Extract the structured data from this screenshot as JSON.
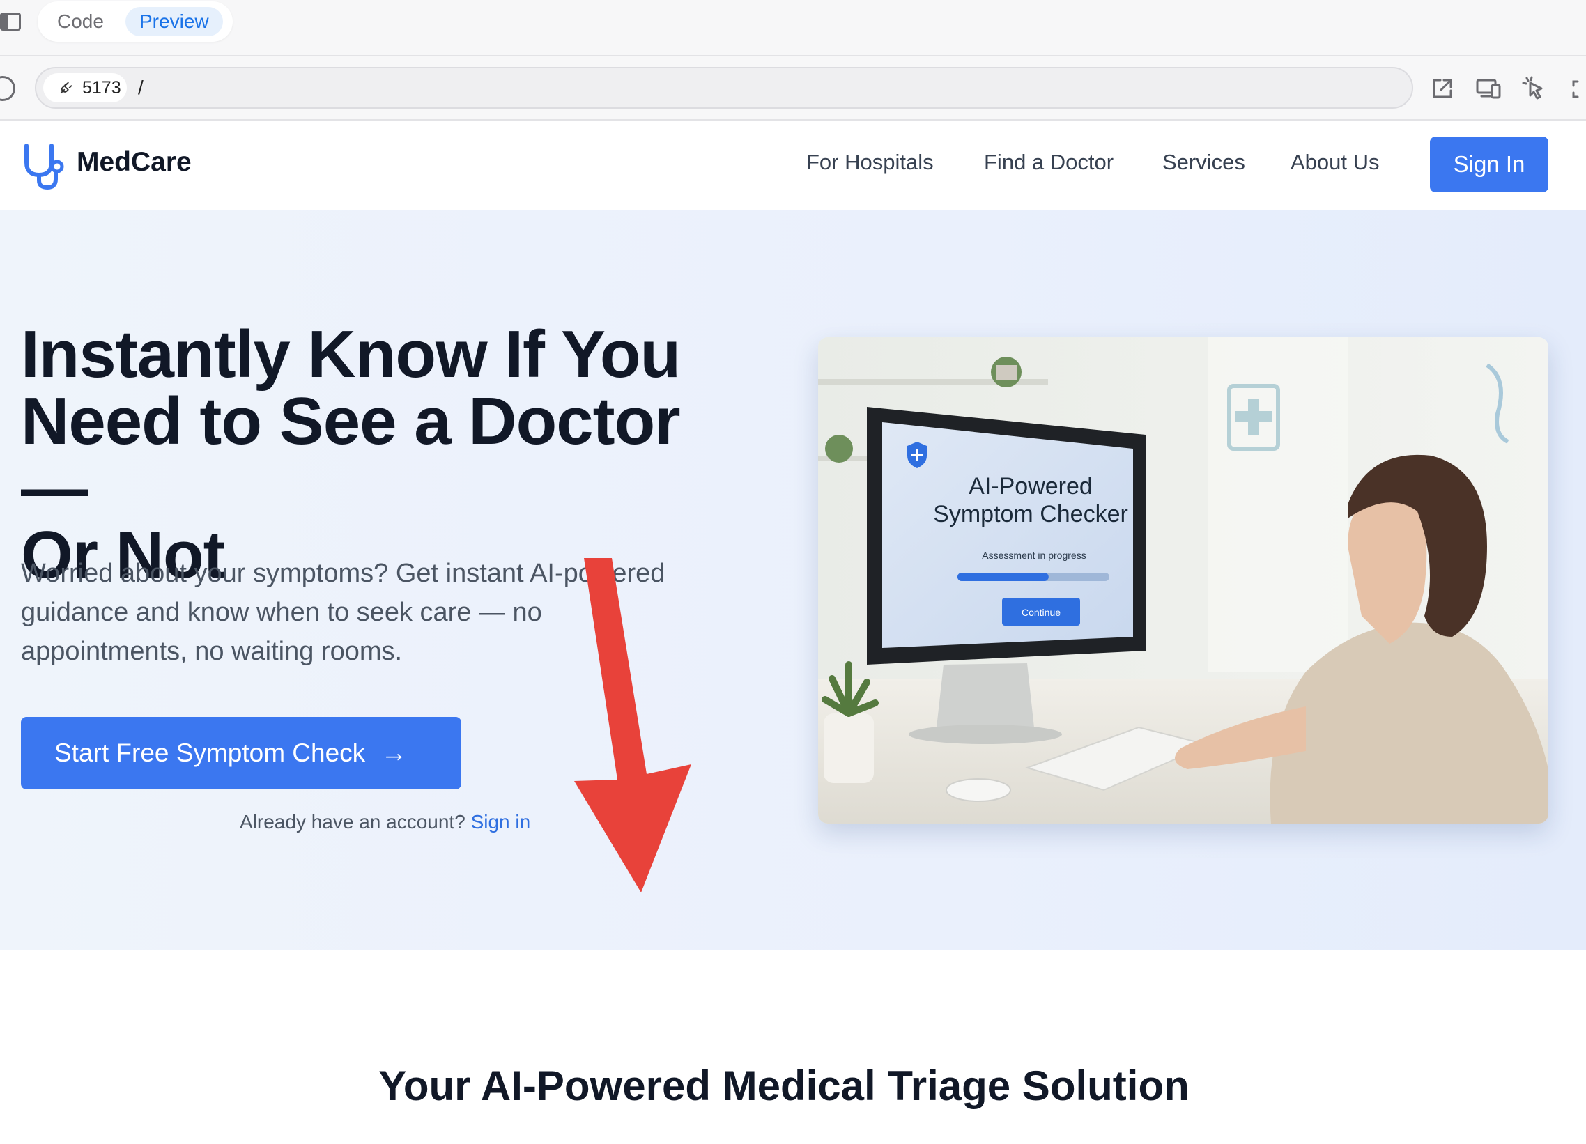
{
  "browser": {
    "tabs": [
      "Code",
      "Preview"
    ],
    "active_tab": "Preview",
    "port": "5173",
    "path": "/",
    "icons": [
      "panel-toggle-icon",
      "reload-icon",
      "plug-icon",
      "open-external-icon",
      "responsive-devices-icon",
      "select-element-icon",
      "fullscreen-icon"
    ]
  },
  "nav": {
    "logo_text": "MedCare",
    "links": [
      "For Hospitals",
      "Find a Doctor",
      "Services",
      "About Us"
    ],
    "signin": "Sign In"
  },
  "hero": {
    "title_lines": [
      "Instantly Know If You",
      "Need to See a Doctor —",
      "Or Not"
    ],
    "subtitle_lines": [
      "Worried about your symptoms? Get instant AI-powered",
      "guidance and know when to seek care — no",
      "appointments, no waiting rooms."
    ],
    "cta": "Start Free Symptom Check",
    "already_text": "Already have an account?",
    "signin_link": "Sign in",
    "image": {
      "screen_title_lines": [
        "AI-Powered",
        "Symptom Checker"
      ],
      "screen_status": "Assessment in progress",
      "screen_button": "Continue",
      "progress": 0.6
    }
  },
  "section": {
    "title": "Your AI-Powered Medical Triage Solution"
  },
  "colors": {
    "primary": "#3b77f0",
    "annotation_arrow": "#e8423a",
    "title": "#111827",
    "hero_bg": "#eaf0fc"
  }
}
